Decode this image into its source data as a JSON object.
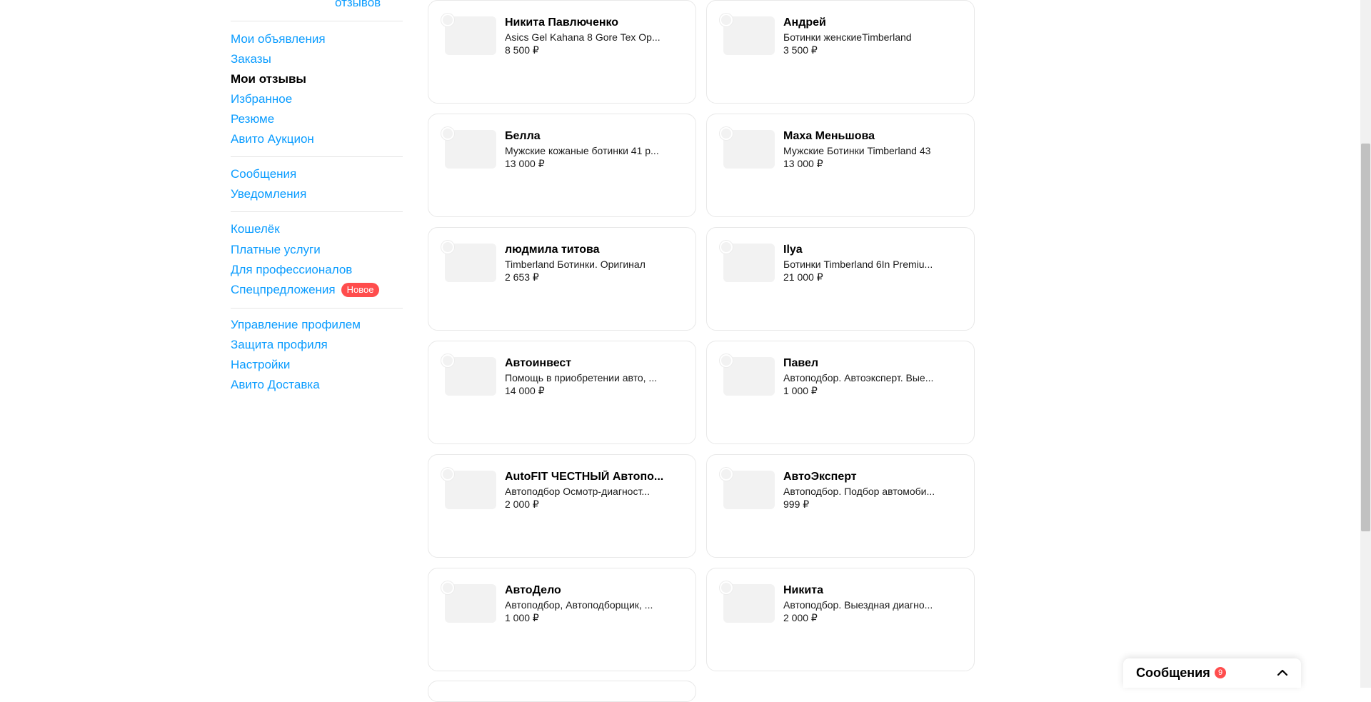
{
  "sidebar": {
    "reviews_link": "отзывов",
    "group1": [
      "Мои объявления",
      "Заказы",
      "Мои отзывы",
      "Избранное",
      "Резюме",
      "Авито Аукцион"
    ],
    "group2": [
      "Сообщения",
      "Уведомления"
    ],
    "group3": [
      "Кошелёк",
      "Платные услуги",
      "Для профессионалов",
      "Спецпредложения"
    ],
    "new_badge": "Новое",
    "group4": [
      "Управление профилем",
      "Защита профиля",
      "Настройки",
      "Авито Доставка"
    ]
  },
  "cards": [
    {
      "name": "Никита Павлюченко",
      "title": "Asics Gel Kahana 8 Gore Tex Ор...",
      "price": "8 500 ₽"
    },
    {
      "name": "Андрей",
      "title": "Ботинки женскиеTimberland",
      "price": "3 500 ₽"
    },
    {
      "name": "Белла",
      "title": "Мужские кожаные ботинки 41 р...",
      "price": "13 000 ₽"
    },
    {
      "name": "Маха Меньшова",
      "title": "Мужские Ботинки Timberland 43",
      "price": "13 000 ₽"
    },
    {
      "name": "людмила титова",
      "title": "Timberland Ботинки. Оригинал",
      "price": "2 653 ₽"
    },
    {
      "name": "Ilya",
      "title": "Ботинки Timberland 6In Premiu...",
      "price": "21 000 ₽"
    },
    {
      "name": "Автоинвест",
      "title": "Помощь в приобретении авто, ...",
      "price": "14 000 ₽"
    },
    {
      "name": "Павел",
      "title": "Автоподбор. Автоэксперт. Вые...",
      "price": "1 000 ₽"
    },
    {
      "name": "AutoFIT ЧЕСТНЫЙ Автопо...",
      "title": "Автоподбор Осмотр-диагност...",
      "price": "2 000 ₽"
    },
    {
      "name": "АвтоЭксперт",
      "title": "Автоподбор. Подбор автомоби...",
      "price": "999 ₽"
    },
    {
      "name": "АвтоДело",
      "title": "Автоподбор, Автоподборщик, ...",
      "price": "1 000 ₽"
    },
    {
      "name": "Никита",
      "title": "Автоподбор. Выездная диагно...",
      "price": "2 000 ₽"
    }
  ],
  "messenger": {
    "label": "Сообщения",
    "count": "9"
  },
  "colors": {
    "link": "#0a9cff",
    "badge": "#ff4d4d",
    "card_border": "#e8e8e8",
    "thumb": "#f2f2f2"
  }
}
